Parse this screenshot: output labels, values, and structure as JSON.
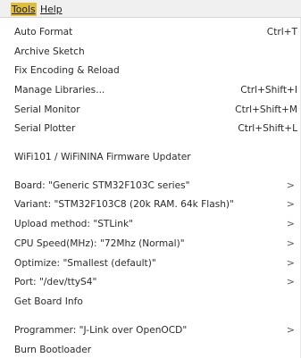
{
  "menubar": {
    "tools_label": "Tools",
    "help_label": "Help"
  },
  "menu": {
    "items": [
      {
        "label": "Auto Format",
        "shortcut": "Ctrl+T"
      },
      {
        "label": "Archive Sketch"
      },
      {
        "label": "Fix Encoding & Reload"
      },
      {
        "label": "Manage Libraries...",
        "shortcut": "Ctrl+Shift+I"
      },
      {
        "label": "Serial Monitor",
        "shortcut": "Ctrl+Shift+M"
      },
      {
        "label": "Serial Plotter",
        "shortcut": "Ctrl+Shift+L"
      },
      {
        "label": "WiFi101 / WiFiNINA Firmware Updater"
      },
      {
        "label": "Board: \"Generic STM32F103C series\"",
        "submenu": ">"
      },
      {
        "label": "Variant: \"STM32F103C8 (20k RAM. 64k Flash)\"",
        "submenu": ">"
      },
      {
        "label": "Upload method: \"STLink\"",
        "submenu": ">"
      },
      {
        "label": "CPU Speed(MHz): \"72Mhz (Normal)\"",
        "submenu": ">"
      },
      {
        "label": "Optimize: \"Smallest (default)\"",
        "submenu": ">"
      },
      {
        "label": "Port: \"/dev/ttyS4\"",
        "submenu": ">"
      },
      {
        "label": "Get Board Info"
      },
      {
        "label": "Programmer: \"J-Link over OpenOCD\"",
        "submenu": ">"
      },
      {
        "label": "Burn Bootloader"
      }
    ]
  }
}
